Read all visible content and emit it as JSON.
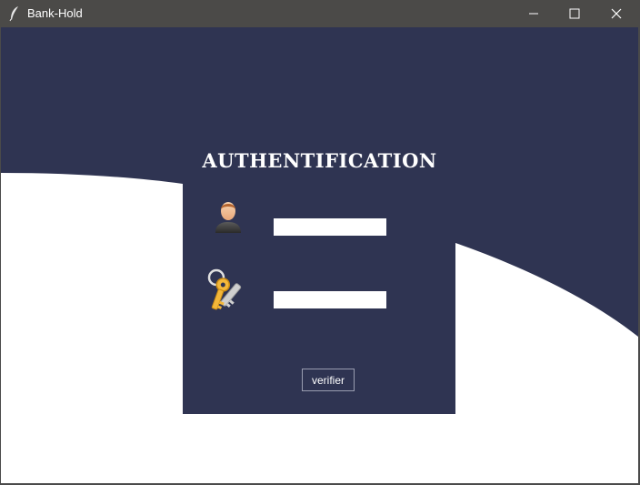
{
  "window": {
    "title": "Bank-Hold",
    "app_icon": "feather-icon",
    "controls": {
      "minimize": "minimize-icon",
      "maximize": "maximize-icon",
      "close": "close-icon"
    }
  },
  "form": {
    "heading": "AUTHENTIFICATION",
    "username_value": "",
    "password_value": "",
    "user_icon": "user-icon",
    "password_icon": "key-icon",
    "submit_label": "verifier"
  },
  "colors": {
    "titlebar": "#4b4a48",
    "background_navy": "#2f3452",
    "background_white": "#ffffff",
    "text": "#ffffff"
  }
}
